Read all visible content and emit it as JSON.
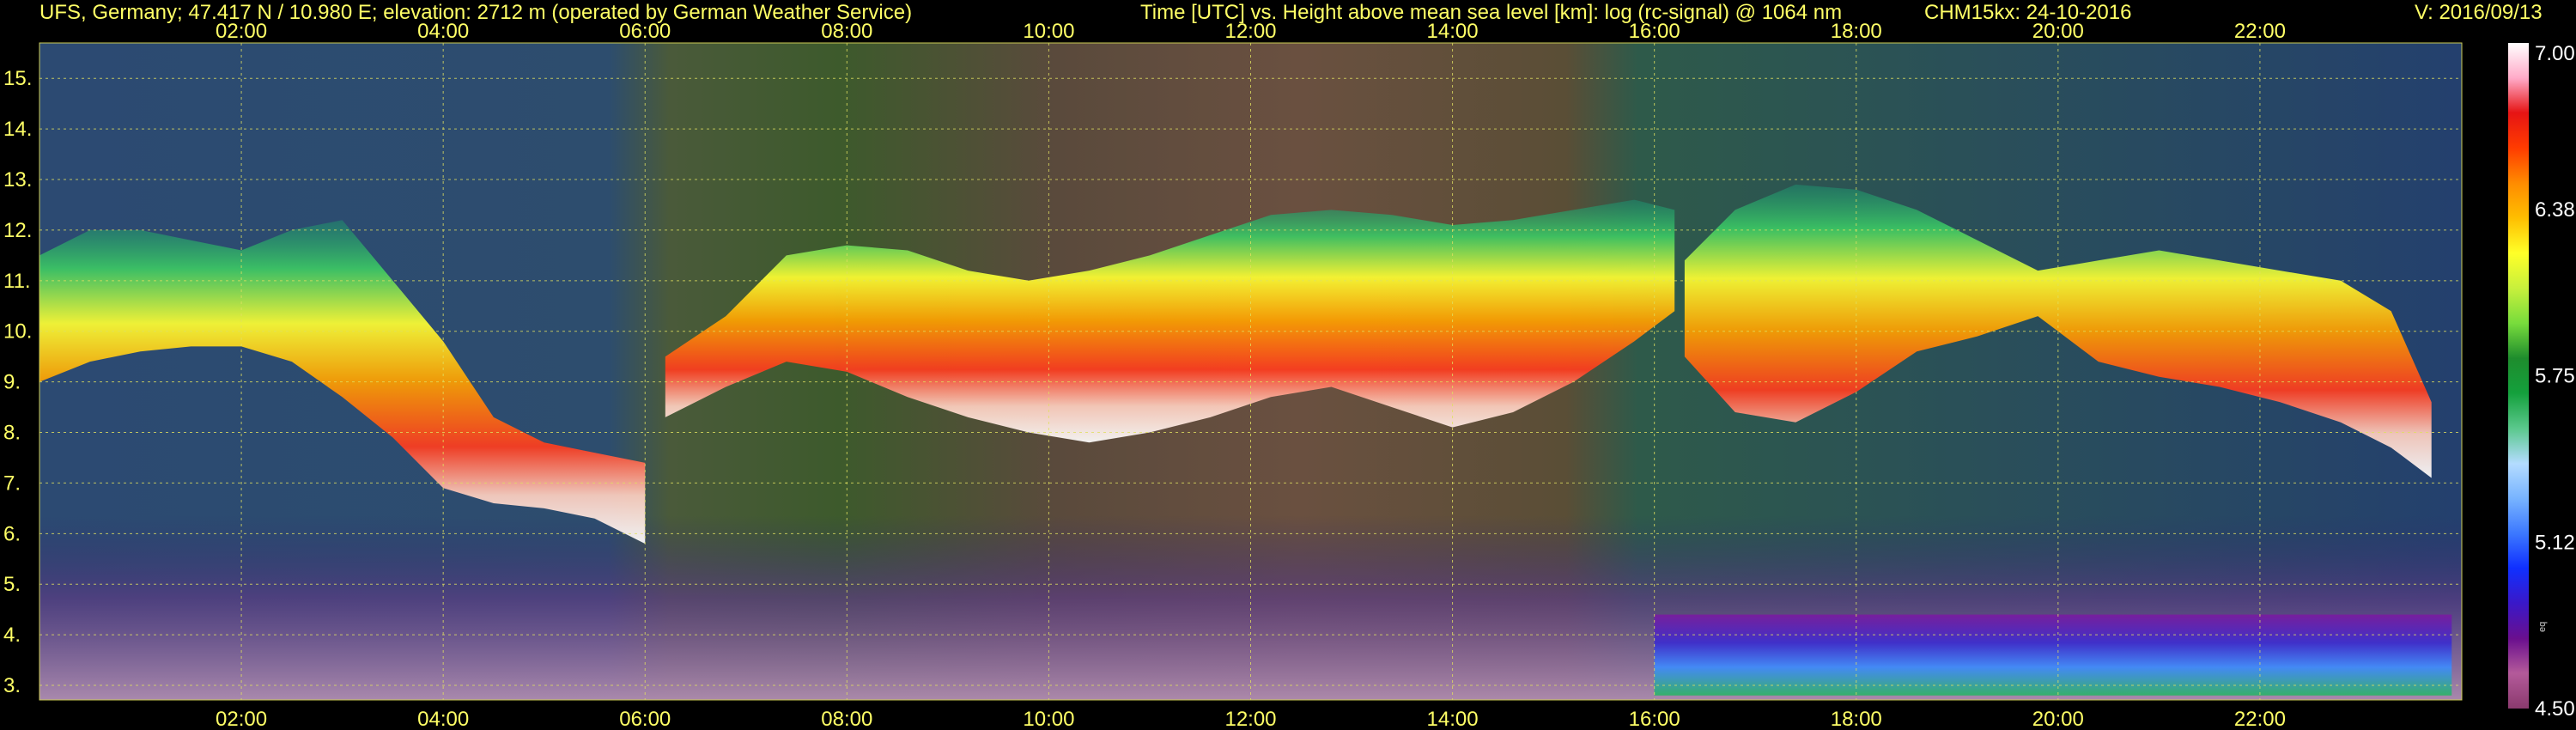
{
  "header": {
    "site": "UFS, Germany; 47.417 N / 10.980 E; elevation: 2712 m  (operated by German Weather Service)",
    "title": "Time [UTC] vs. Height above mean sea level [km]: log (rc-signal) @ 1064 nm",
    "instrument": "CHM15kx: 24-10-2016",
    "version": "V: 2016/09/13"
  },
  "chart_data": {
    "type": "heatmap",
    "title": "Time [UTC] vs. Height above mean sea level [km]: log (rc-signal) @ 1064 nm",
    "xlabel": "Time [UTC]",
    "ylabel": "Height above mean sea level [km]",
    "x_ticks": [
      "02:00",
      "04:00",
      "06:00",
      "08:00",
      "10:00",
      "12:00",
      "14:00",
      "16:00",
      "18:00",
      "20:00",
      "22:00"
    ],
    "x_tick_hours": [
      2,
      4,
      6,
      8,
      10,
      12,
      14,
      16,
      18,
      20,
      22
    ],
    "xlim_hours": [
      0,
      24
    ],
    "y_ticks": [
      "3.",
      "4.",
      "5.",
      "6.",
      "7.",
      "8.",
      "9.",
      "10.",
      "11.",
      "12.",
      "13.",
      "14.",
      "15."
    ],
    "y_tick_values": [
      3,
      4,
      5,
      6,
      7,
      8,
      9,
      10,
      11,
      12,
      13,
      14,
      15
    ],
    "ylim": [
      2.712,
      15.7
    ],
    "grid": true,
    "colorbar": {
      "ticks": [
        "7.00",
        "6.38",
        "5.75",
        "5.12",
        "4.50"
      ],
      "values": [
        7.0,
        6.375,
        5.75,
        5.125,
        4.5
      ],
      "range": [
        4.5,
        7.0
      ],
      "colors": [
        "#8b3a6e",
        "#b45a9a",
        "#6a0f8e",
        "#3a18c8",
        "#1030ff",
        "#3c78ff",
        "#78b4ff",
        "#b4dcff",
        "#5ac88c",
        "#14a03c",
        "#1e8c2d",
        "#78dc3c",
        "#c8f03c",
        "#ffff28",
        "#ffbe00",
        "#ff8c00",
        "#ff3c00",
        "#e61414",
        "#ffaac8",
        "#ffffff"
      ]
    },
    "cloud_layers": [
      {
        "t": [
          0.0,
          0.5,
          1.0,
          1.5,
          2.0,
          2.5,
          3.0,
          3.5,
          4.0,
          4.5,
          5.0,
          5.5,
          6.0
        ],
        "base": [
          9.0,
          9.4,
          9.6,
          9.7,
          9.7,
          9.4,
          8.7,
          7.9,
          6.9,
          6.6,
          6.5,
          6.3,
          5.8
        ],
        "top": [
          11.5,
          12.0,
          12.0,
          11.8,
          11.6,
          12.0,
          12.2,
          11.0,
          9.8,
          8.3,
          7.8,
          7.6,
          7.4
        ]
      },
      {
        "t": [
          6.2,
          6.8,
          7.4,
          8.0,
          8.6,
          9.2,
          9.8,
          10.4,
          11.0,
          11.6,
          12.2,
          12.8,
          13.4,
          14.0,
          14.6,
          15.2,
          15.8,
          16.2
        ],
        "base": [
          8.3,
          8.9,
          9.4,
          9.2,
          8.7,
          8.3,
          8.0,
          7.8,
          8.0,
          8.3,
          8.7,
          8.9,
          8.5,
          8.1,
          8.4,
          9.0,
          9.8,
          10.4
        ],
        "top": [
          9.5,
          10.3,
          11.5,
          11.7,
          11.6,
          11.2,
          11.0,
          11.2,
          11.5,
          11.9,
          12.3,
          12.4,
          12.3,
          12.1,
          12.2,
          12.4,
          12.6,
          12.4
        ]
      },
      {
        "t": [
          16.3,
          16.8,
          17.4,
          18.0,
          18.6,
          19.2,
          19.8,
          20.4,
          21.0,
          21.6,
          22.2,
          22.8,
          23.3,
          23.7
        ],
        "base": [
          9.5,
          8.4,
          8.2,
          8.8,
          9.6,
          9.9,
          10.3,
          9.4,
          9.1,
          8.9,
          8.6,
          8.2,
          7.7,
          7.1
        ],
        "top": [
          11.4,
          12.4,
          12.9,
          12.8,
          12.4,
          11.8,
          11.2,
          11.4,
          11.6,
          11.4,
          11.2,
          11.0,
          10.4,
          8.6
        ]
      }
    ],
    "aerosol_layer": {
      "t_start": 16.0,
      "t_end": 23.9,
      "base": 2.8,
      "top": 4.4
    }
  }
}
